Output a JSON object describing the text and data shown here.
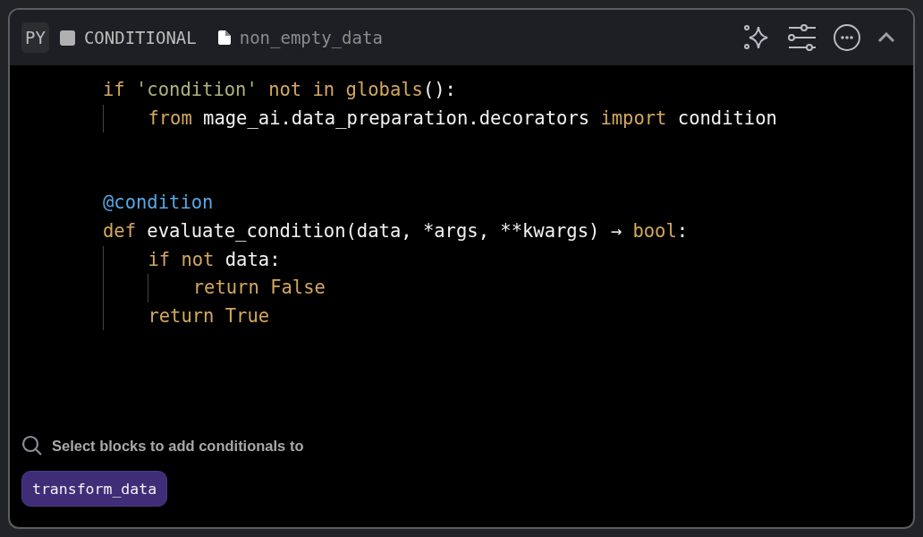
{
  "header": {
    "language": "PY",
    "block_type": "CONDITIONAL",
    "block_name": "non_empty_data",
    "collapsed": false
  },
  "code": [
    {
      "kind": "code",
      "tokens": [
        {
          "text": "if ",
          "kind": "kw"
        },
        {
          "text": "'condition' ",
          "kind": "str"
        },
        {
          "text": "not in globals",
          "kind": "kw"
        },
        {
          "text": "():",
          "kind": "plain"
        }
      ]
    },
    {
      "kind": "code",
      "tokens": [
        {
          "text": "    from",
          "kind": "kw"
        },
        {
          "text": " mage_ai.data_preparation.decorators ",
          "kind": "plain"
        },
        {
          "text": "import",
          "kind": "kw"
        },
        {
          "text": " condition",
          "kind": "plain"
        }
      ]
    },
    {
      "kind": "blank"
    },
    {
      "kind": "blank"
    },
    {
      "kind": "code",
      "tokens": [
        {
          "text": "@condition",
          "kind": "deco"
        }
      ]
    },
    {
      "kind": "code",
      "tokens": [
        {
          "text": "def",
          "kind": "kw"
        },
        {
          "text": " evaluate_condition(data, *args, **kwargs) → ",
          "kind": "plain"
        },
        {
          "text": "bool",
          "kind": "kw"
        },
        {
          "text": ":",
          "kind": "plain"
        }
      ]
    },
    {
      "kind": "code",
      "tokens": [
        {
          "text": "    if not",
          "kind": "kw"
        },
        {
          "text": " data:",
          "kind": "plain"
        }
      ]
    },
    {
      "kind": "code",
      "tokens": [
        {
          "text": "        return False",
          "kind": "kw"
        }
      ]
    },
    {
      "kind": "code",
      "tokens": [
        {
          "text": "    return True",
          "kind": "kw"
        }
      ]
    }
  ],
  "block_search": {
    "placeholder": "Select blocks to add conditionals to"
  },
  "selected_blocks": [
    {
      "label": "transform_data"
    }
  ]
}
